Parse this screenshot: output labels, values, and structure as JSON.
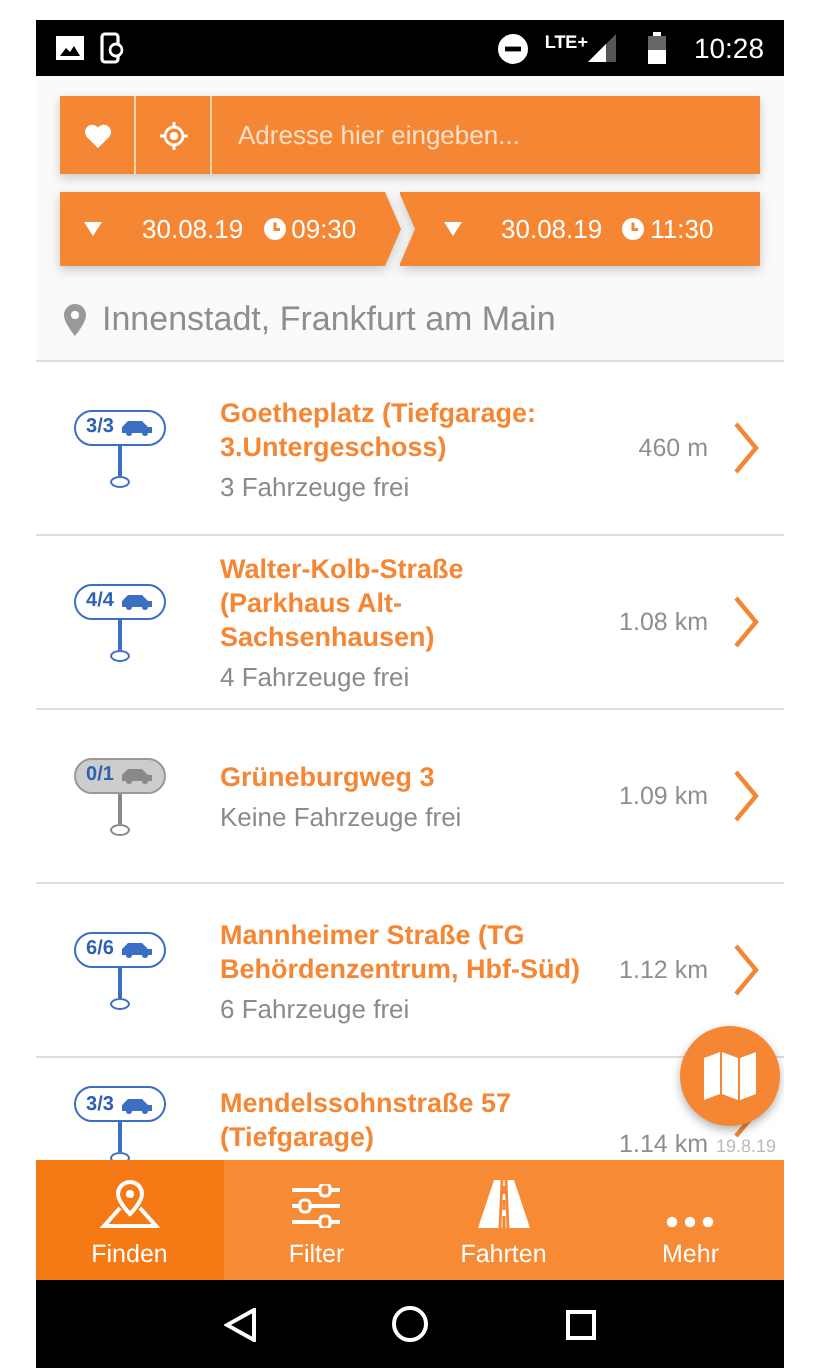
{
  "status_bar": {
    "network": "LTE+",
    "time": "10:28"
  },
  "search": {
    "placeholder": "Adresse hier eingeben..."
  },
  "period": [
    {
      "date": "30.08.19",
      "time": "09:30"
    },
    {
      "date": "30.08.19",
      "time": "11:30"
    }
  ],
  "location": "Innenstadt, Frankfurt am Main",
  "stations": [
    {
      "badge": "3/3",
      "available": true,
      "name": "Goetheplatz (Tiefgarage: 3.Untergeschoss)",
      "vehicles": "3 Fahrzeuge frei",
      "distance": "460 m"
    },
    {
      "badge": "4/4",
      "available": true,
      "name": "Walter-Kolb-Straße (Parkhaus Alt-Sachsenhausen)",
      "vehicles": "4 Fahrzeuge frei",
      "distance": "1.08 km"
    },
    {
      "badge": "0/1",
      "available": false,
      "name": "Grüneburgweg 3",
      "vehicles": "Keine Fahrzeuge frei",
      "distance": "1.09 km"
    },
    {
      "badge": "6/6",
      "available": true,
      "name": "Mannheimer Straße (TG Behördenzentrum, Hbf-Süd)",
      "vehicles": "6 Fahrzeuge frei",
      "distance": "1.12 km"
    },
    {
      "badge": "3/3",
      "available": true,
      "name": "Mendelssohnstraße 57 (Tiefgarage)",
      "distance": "1.14 km"
    }
  ],
  "overlay_label": "19.8.19",
  "tabs": [
    {
      "label": "Finden",
      "kind": "pin",
      "selected": true
    },
    {
      "label": "Filter",
      "kind": "sliders",
      "selected": false
    },
    {
      "label": "Fahrten",
      "kind": "road",
      "selected": false
    },
    {
      "label": "Mehr",
      "kind": "dots",
      "selected": false
    }
  ]
}
